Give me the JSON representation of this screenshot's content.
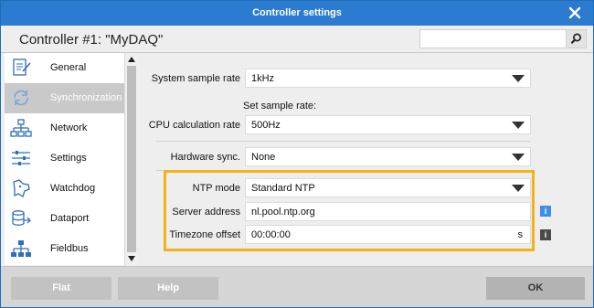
{
  "window": {
    "title": "Controller settings"
  },
  "header": {
    "controller_title": "Controller #1: \"MyDAQ\"",
    "search_value": ""
  },
  "sidebar": {
    "items": [
      {
        "label": "General",
        "icon": "general-icon",
        "active": false
      },
      {
        "label": "Synchronization",
        "icon": "sync-icon",
        "active": true
      },
      {
        "label": "Network",
        "icon": "network-icon",
        "active": false
      },
      {
        "label": "Settings",
        "icon": "settings-sliders-icon",
        "active": false
      },
      {
        "label": "Watchdog",
        "icon": "watchdog-icon",
        "active": false
      },
      {
        "label": "Dataport",
        "icon": "database-icon",
        "active": false
      },
      {
        "label": "Fieldbus",
        "icon": "fieldbus-icon",
        "active": false
      }
    ]
  },
  "content": {
    "system_sample_rate": {
      "label": "System sample rate",
      "value": "1kHz"
    },
    "set_sample_rate_label": "Set sample rate:",
    "cpu_calc_rate": {
      "label": "CPU calculation rate",
      "value": "500Hz"
    },
    "hardware_sync": {
      "label": "Hardware sync.",
      "value": "None"
    },
    "ntp_mode": {
      "label": "NTP mode",
      "value": "Standard NTP"
    },
    "server_address": {
      "label": "Server address",
      "value": "nl.pool.ntp.org",
      "info": "i"
    },
    "timezone_offset": {
      "label": "Timezone offset",
      "value": "00:00:00",
      "unit": "s",
      "info": "i"
    }
  },
  "footer": {
    "flat_label": "Flat",
    "help_label": "Help",
    "ok_label": "OK"
  },
  "colors": {
    "titlebar": "#2b7bd0",
    "highlight": "#f2b21b",
    "info_blue": "#3d8ee6",
    "info_dark": "#4a4a4a"
  }
}
